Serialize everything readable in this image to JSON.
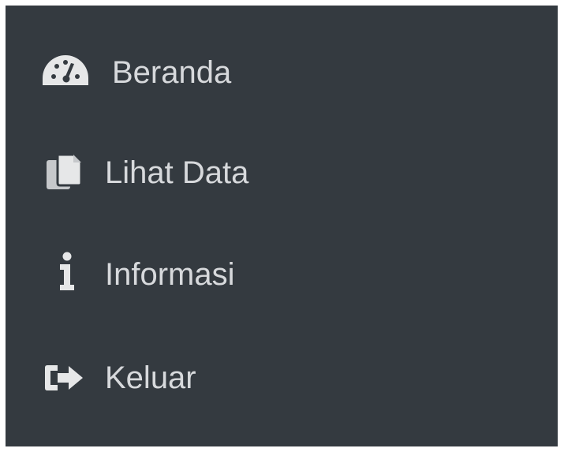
{
  "sidebar": {
    "items": [
      {
        "label": "Beranda",
        "icon": "tachometer-icon"
      },
      {
        "label": "Lihat Data",
        "icon": "copy-icon"
      },
      {
        "label": "Informasi",
        "icon": "info-icon"
      },
      {
        "label": "Keluar",
        "icon": "sign-out-icon"
      }
    ]
  },
  "colors": {
    "sidebar_background": "#343a40",
    "text": "#d7d9dc",
    "icon": "#e6e7e8"
  }
}
